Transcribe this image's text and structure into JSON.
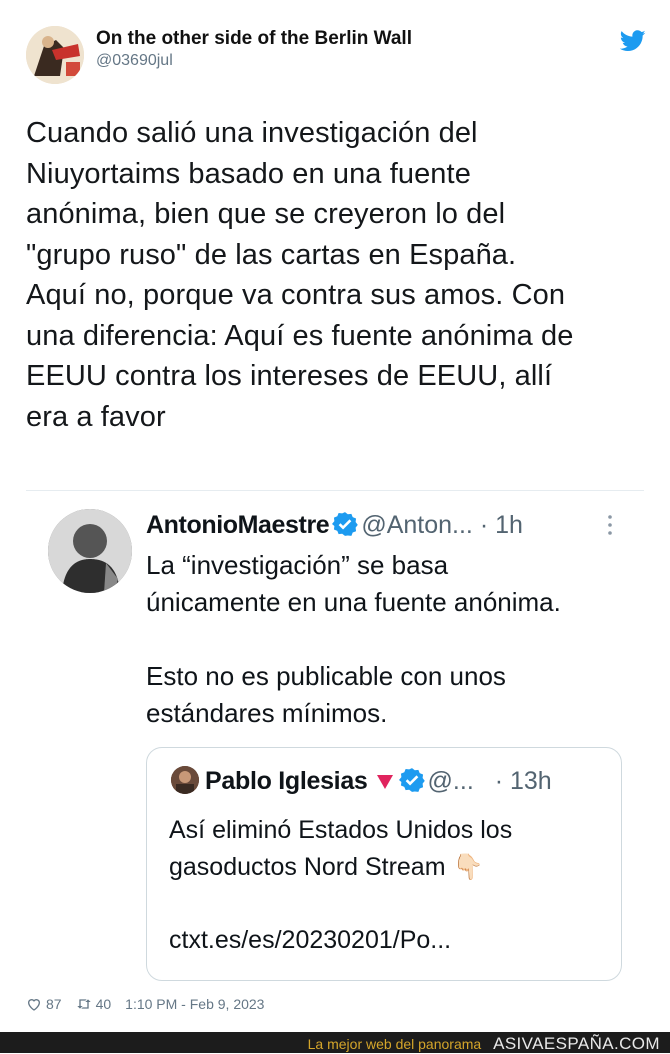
{
  "tweet": {
    "author_name": "On the other side of the Berlin Wall",
    "author_handle": "@03690jul",
    "text": "Cuando salió una investigación del\nNiuyortaims basado en una fuente\nanónima, bien que se creyeron lo del\n\"grupo ruso\" de las cartas en España.\nAquí no, porque va contra sus amos. Con\nuna diferencia: Aquí es fuente anónima de\nEEUU contra los intereses de EEUU, allí\nera a favor",
    "likes": "87",
    "retweets": "40",
    "timestamp": "1:10 PM - Feb 9, 2023"
  },
  "embedded": {
    "author_name": "AntonioMaestre",
    "author_handle": "@Anton...",
    "time": "· 1h",
    "text": "La “investigación” se basa\núnicamente en una fuente anónima.\n\nEsto no es publicable con unos\nestándares mínimos.",
    "quote": {
      "author_name": "Pablo Iglesias",
      "author_handle": "@...",
      "time": "· 13h",
      "text": "Así eliminó Estados Unidos los\ngasoductos Nord Stream 👇🏻",
      "link": "ctxt.es/es/20230201/Po..."
    }
  },
  "banner": {
    "tagline": "La mejor web del panorama",
    "brand": "ASIVAESPAÑA.COM"
  },
  "colors": {
    "twitter_blue": "#1d9bf0",
    "verified_blue": "#1d9bf0",
    "triangle_red": "#e0245e",
    "banner_bg": "#1c1c1c",
    "banner_text": "#d4a52a"
  },
  "icons": [
    "twitter-bird-icon",
    "verified-badge-icon",
    "kebab-menu-icon",
    "heart-icon",
    "retweet-icon",
    "red-triangle-icon"
  ]
}
